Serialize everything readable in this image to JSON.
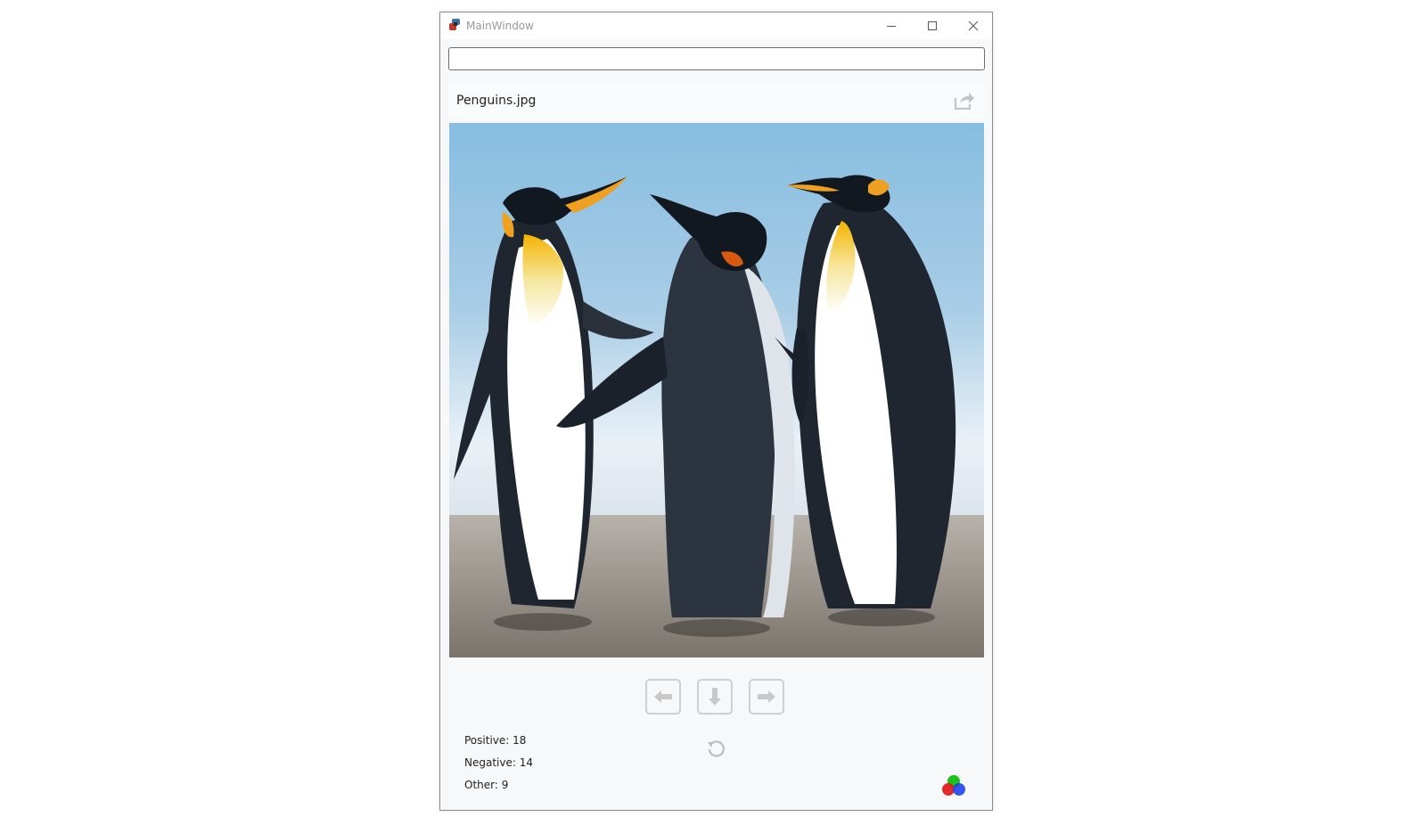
{
  "window": {
    "title": "MainWindow"
  },
  "search": {
    "value": "",
    "placeholder": ""
  },
  "file": {
    "name": "Penguins.jpg"
  },
  "stats": {
    "positive": "Positive: 18",
    "negative": "Negative: 14",
    "other": "Other: 9"
  },
  "icons": {
    "app": "python-icon",
    "share": "share-icon",
    "prev": "arrow-left-icon",
    "down": "arrow-down-icon",
    "next": "arrow-right-icon",
    "reset": "undo-icon",
    "color": "rgb-circles-icon"
  },
  "colors": {
    "window_bg": "#f7f8fa",
    "button_border": "#cfcfcf",
    "icon_gray": "#b8b8b8"
  }
}
